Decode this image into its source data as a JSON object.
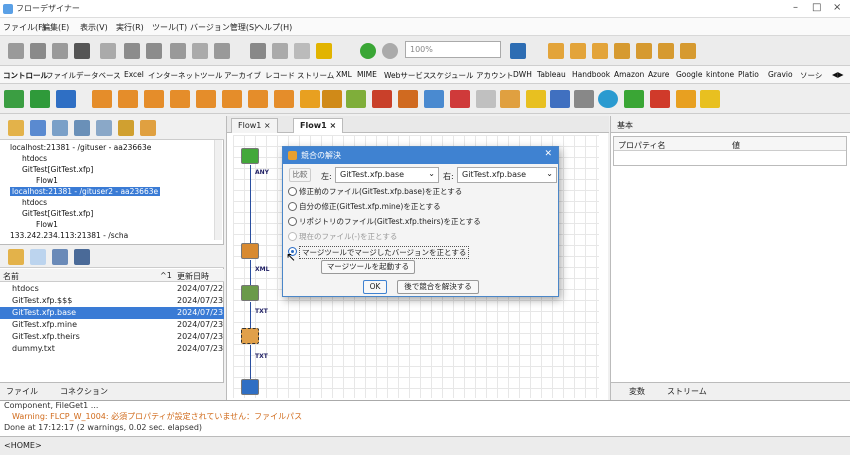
{
  "app": {
    "title": "フローデザイナー"
  },
  "menu": [
    "ファイル(F)",
    "編集(E)",
    "表示(V)",
    "実行(R)",
    "ツール(T)",
    "バージョン管理(S)",
    "ヘルプ(H)"
  ],
  "toolbar": {
    "zoom_placeholder": "100%"
  },
  "category_tabs": [
    "コントロール",
    "ファイル",
    "データベース",
    "Excel",
    "インターネット",
    "ツール",
    "アーカイブ",
    "レコード",
    "ストリーム",
    "XML",
    "MIME",
    "Webサービス",
    "スケジュール",
    "アカウント",
    "DWH",
    "Tableau",
    "Handbook",
    "Amazon",
    "Azure",
    "Google",
    "kintone",
    "Platio",
    "Gravio",
    "ソーシ"
  ],
  "repo_tree": [
    {
      "label": "localhost:21381 - /gituser - aa23663e"
    },
    {
      "label": "htdocs"
    },
    {
      "label": "GitTest[GitTest.xfp]"
    },
    {
      "label": "Flow1"
    },
    {
      "label": "localhost:21381 - /gituser2 - aa23663e"
    },
    {
      "label": "htdocs"
    },
    {
      "label": "GitTest[GitTest.xfp]"
    },
    {
      "label": "Flow1"
    },
    {
      "label": "133.242.234.113:21381 - /scha"
    }
  ],
  "file_list": {
    "col_name": "名前",
    "col_sort": "^1",
    "col_date": "更新日時",
    "rows": [
      {
        "name": "htdocs",
        "date": "2024/07/22"
      },
      {
        "name": "GitTest.xfp.$$$",
        "date": "2024/07/23"
      },
      {
        "name": "GitTest.xfp.base",
        "date": "2024/07/23"
      },
      {
        "name": "GitTest.xfp.mine",
        "date": "2024/07/23"
      },
      {
        "name": "GitTest.xfp.theirs",
        "date": "2024/07/23"
      },
      {
        "name": "dummy.txt",
        "date": "2024/07/23"
      }
    ]
  },
  "left_tabs": [
    "ファイル",
    "コネクション"
  ],
  "canvas_tabs": [
    "Flow1",
    "Flow1"
  ],
  "flow_labels": [
    "ANY",
    "XML",
    "TXT",
    "TXT"
  ],
  "properties": {
    "tab": "基本",
    "col_name": "プロパティ名",
    "col_value": "値"
  },
  "right_tabs": [
    "変数",
    "ストリーム"
  ],
  "console": {
    "line1": "Component, FileGet1 ...",
    "line2": "Warning: FLCP_W_1004: 必須プロパティが設定されていません：ファイルパス",
    "line3": "Done at 17:12:17 (2 warnings, 0.02 sec. elapsed)"
  },
  "status": "<HOME>",
  "dialog": {
    "title": "競合の解決",
    "compare_label": "比較",
    "left_label": "左:",
    "left_value": "GitTest.xfp.base",
    "right_label": "右:",
    "right_value": "GitTest.xfp.base",
    "options": [
      "修正前のファイル(GitTest.xfp.base)を正とする",
      "自分の修正(GitTest.xfp.mine)を正とする",
      "リポジトリのファイル(GitTest.xfp.theirs)を正とする",
      "現在のファイル(-)を正とする",
      "マージツールでマージしたバージョンを正とする"
    ],
    "merge_tool_button": "マージツールを起動する",
    "ok_button": "OK",
    "later_button": "後で競合を解決する"
  }
}
